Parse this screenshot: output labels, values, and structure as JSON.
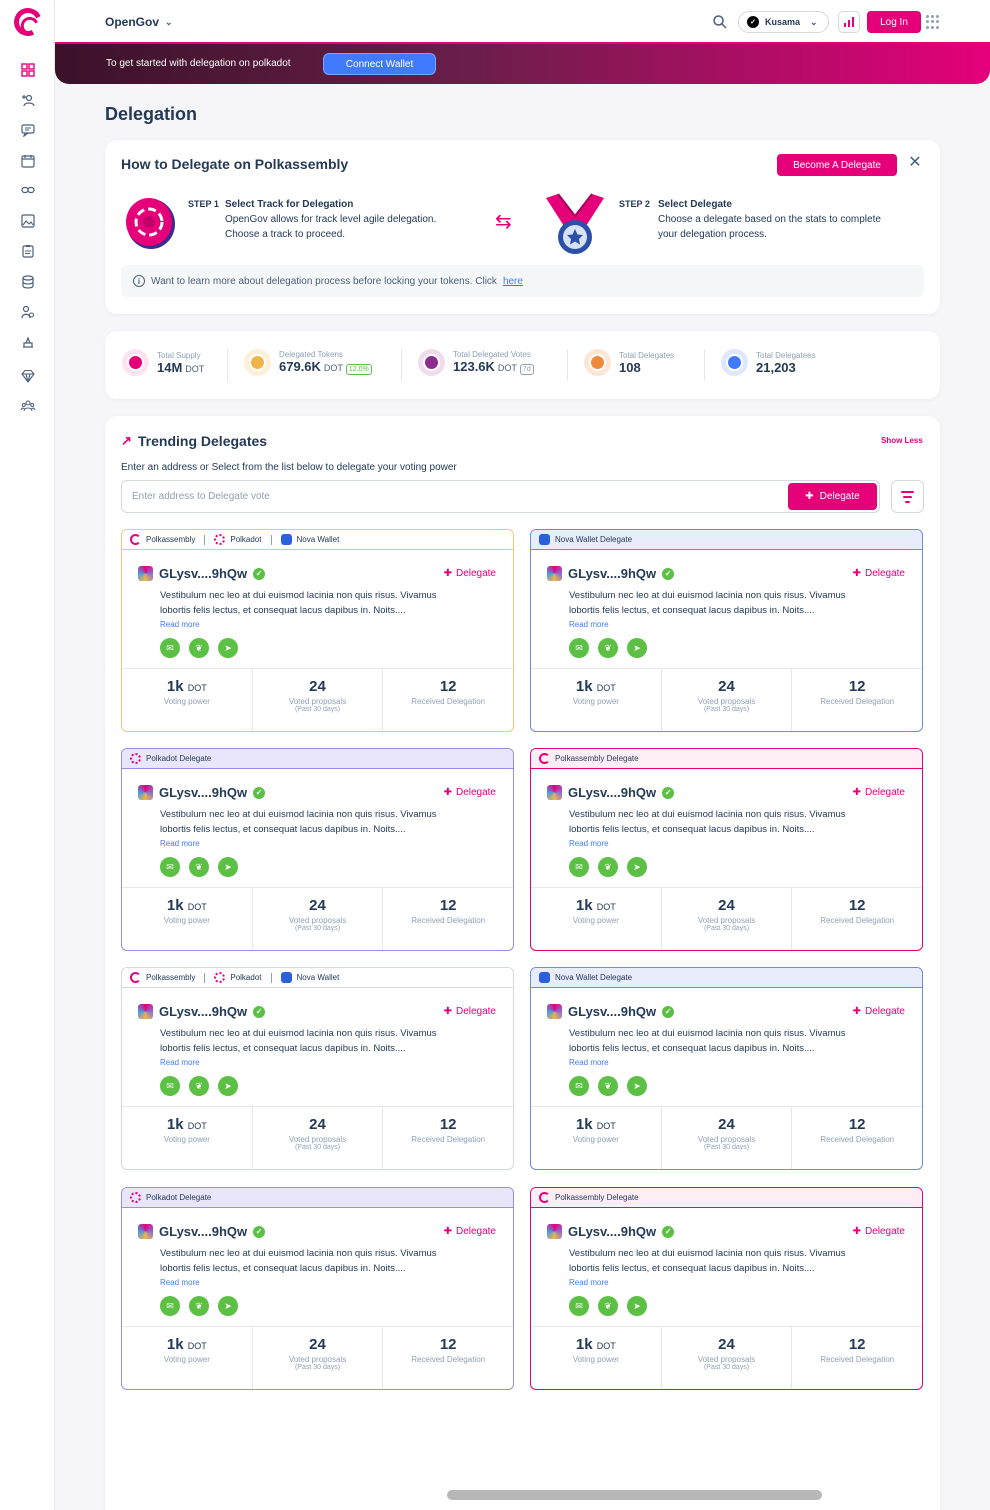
{
  "sidebar": {
    "icons": [
      "overview-icon",
      "delegation-icon",
      "discussions-icon",
      "calendar-icon",
      "link-icon",
      "gallery-icon",
      "clipboard-icon",
      "database-icon",
      "users-icon",
      "treasury-icon",
      "gem-icon",
      "people-icon"
    ]
  },
  "topbar": {
    "section_selector": "OpenGov",
    "network": "Kusama",
    "login_label": "Log In"
  },
  "banner": {
    "text": "To get started with delegation on polkadot",
    "connect_label": "Connect Wallet"
  },
  "page_title": "Delegation",
  "howto": {
    "title": "How to Delegate on Polkassembly",
    "become_label": "Become A Delegate",
    "step1_label": "STEP 1",
    "step1_title": "Select Track for Delegation",
    "step1_line1": "OpenGov allows for track level agile delegation.",
    "step1_line2": "Choose a track to proceed.",
    "step2_label": "STEP 2",
    "step2_title": "Select Delegate",
    "step2_line1": "Choose a delegate based on the stats to complete",
    "step2_line2": "your delegation process.",
    "learn_text": "Want to learn more about delegation process before locking your tokens. Click",
    "learn_link": "here"
  },
  "stats": [
    {
      "label": "Total Supply",
      "value": "14M",
      "unit": "DOT",
      "badge": "",
      "color": "#e5007a"
    },
    {
      "label": "Delegated Tokens",
      "value": "679.6K",
      "unit": "DOT",
      "badge": "12.0%",
      "color": "#f0b548"
    },
    {
      "label": "Total Delegated Votes",
      "value": "123.6K",
      "unit": "DOT",
      "badge": "7d",
      "color": "#8a2d8f"
    },
    {
      "label": "Total Delegates",
      "value": "108",
      "unit": "",
      "badge": "",
      "color": "#ef8a3a"
    },
    {
      "label": "Total Delegatees",
      "value": "21,203",
      "unit": "",
      "badge": "",
      "color": "#407bff"
    }
  ],
  "trending": {
    "title": "Trending Delegates",
    "show_less": "Show Less",
    "subtitle": "Enter an address or Select from the list below to delegate your voting power",
    "input_placeholder": "Enter address to Delegate vote",
    "delegate_label": "Delegate"
  },
  "delegate_card": {
    "name": "GLysv....9hQw",
    "delegate_label": "Delegate",
    "desc_line1": "Vestibulum nec leo at dui euismod lacinia non quis risus. Vivamus",
    "desc_line2": "lobortis felis lectus, et consequat lacus dapibus in. Noits....",
    "read_more": "Read more",
    "voting_power_value": "1k",
    "voting_power_unit": "DOT",
    "voting_power_label": "Voting power",
    "voted_value": "24",
    "voted_label": "Voted proposals",
    "voted_sub": "(Past 30 days)",
    "received_value": "12",
    "received_label": "Received Delegation"
  },
  "card_headers": {
    "multi": [
      "Polkassembly",
      "Polkadot",
      "Nova Wallet"
    ],
    "nova": "Nova Wallet Delegate",
    "polkadot": "Polkadot Delegate",
    "polkassembly": "Polkassembly Delegate"
  }
}
